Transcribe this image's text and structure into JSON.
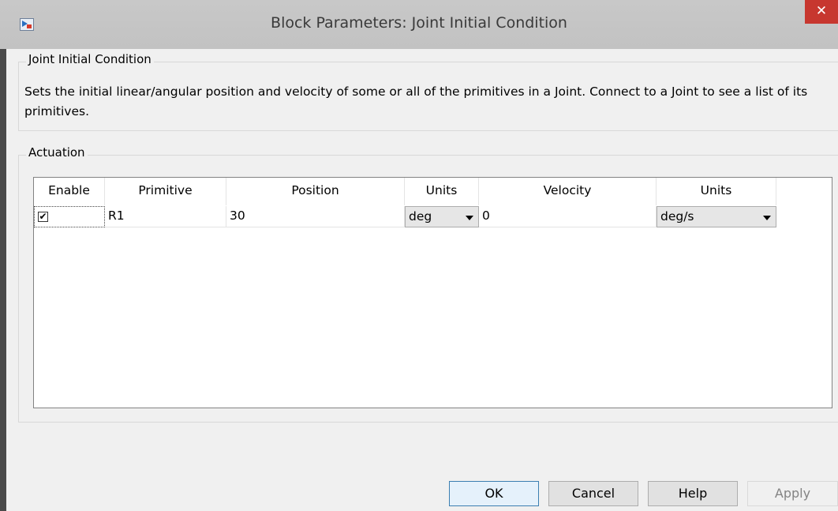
{
  "window": {
    "title": "Block Parameters: Joint Initial Condition",
    "close_label": "✕"
  },
  "group_main": {
    "legend": "Joint Initial Condition",
    "description": "Sets the initial linear/angular position and velocity of some or all of the primitives in a Joint. Connect to a Joint to see a list of its primitives."
  },
  "group_actuation": {
    "legend": "Actuation"
  },
  "table": {
    "headers": {
      "enable": "Enable",
      "primitive": "Primitive",
      "position": "Position",
      "units1": "Units",
      "velocity": "Velocity",
      "units2": "Units"
    },
    "rows": [
      {
        "enabled": "✔",
        "primitive": "R1",
        "position": "30",
        "position_units": "deg",
        "velocity": "0",
        "velocity_units": "deg/s"
      }
    ]
  },
  "buttons": {
    "ok": "OK",
    "cancel": "Cancel",
    "help": "Help",
    "apply": "Apply"
  }
}
